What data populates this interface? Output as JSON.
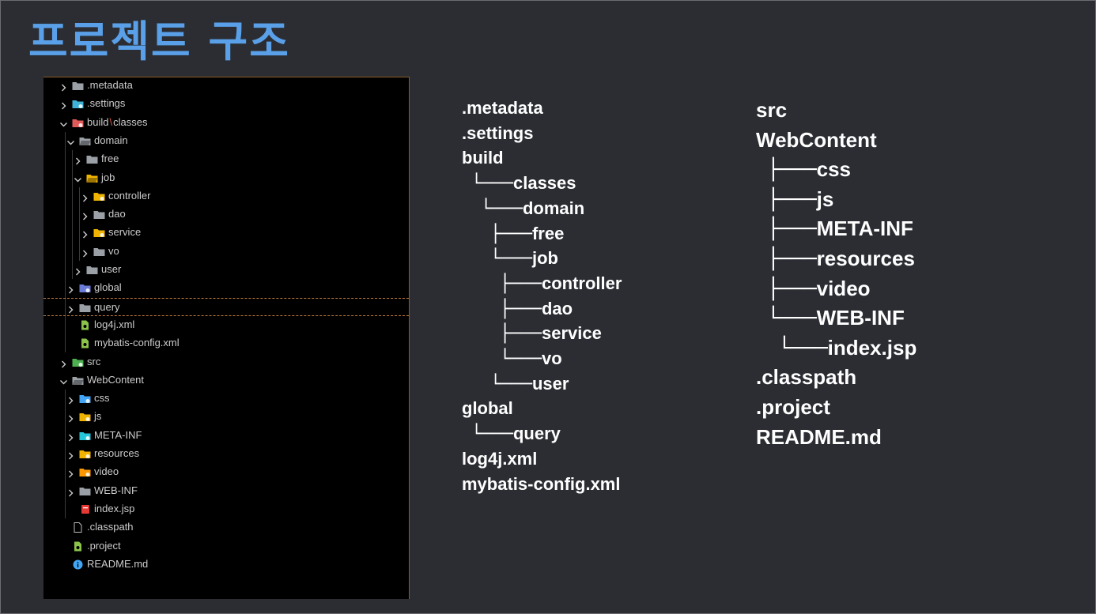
{
  "title": "프로젝트 구조",
  "explorer": {
    "items": [
      {
        "label": ".metadata",
        "icon": "folder-icon",
        "expanded": false,
        "color": "#9aa0a6"
      },
      {
        "label": ".settings",
        "icon": "settings-folder-icon",
        "expanded": false,
        "color": "#3fb2d6"
      },
      {
        "label": "build",
        "label_sep": "\\",
        "label_tail": "classes",
        "icon": "build-folder-icon",
        "expanded": true,
        "color": "#e05a5a"
      },
      {
        "label": "domain",
        "icon": "open-folder-icon",
        "expanded": true,
        "color": "#9aa0a6"
      },
      {
        "label": "free",
        "icon": "folder-icon",
        "expanded": false,
        "color": "#9aa0a6"
      },
      {
        "label": "job",
        "icon": "open-folder-icon",
        "expanded": true,
        "color": "#f0b400"
      },
      {
        "label": "controller",
        "icon": "controller-folder-icon",
        "expanded": false,
        "color": "#f0b400"
      },
      {
        "label": "dao",
        "icon": "folder-icon",
        "expanded": false,
        "color": "#9aa0a6"
      },
      {
        "label": "service",
        "icon": "service-folder-icon",
        "expanded": false,
        "color": "#f0b400"
      },
      {
        "label": "vo",
        "icon": "folder-icon",
        "expanded": false,
        "color": "#9aa0a6"
      },
      {
        "label": "user",
        "icon": "folder-icon",
        "expanded": false,
        "color": "#9aa0a6"
      },
      {
        "label": "global",
        "icon": "global-folder-icon",
        "expanded": false,
        "color": "#6a7bd8"
      },
      {
        "label": "query",
        "icon": "folder-icon",
        "expanded": false,
        "color": "#9aa0a6"
      },
      {
        "label": "log4j.xml",
        "icon": "xml-file-icon",
        "color": "#8bc34a"
      },
      {
        "label": "mybatis-config.xml",
        "icon": "xml-file-icon",
        "color": "#8bc34a"
      },
      {
        "label": "src",
        "icon": "src-folder-icon",
        "expanded": false,
        "color": "#4caf50"
      },
      {
        "label": "WebContent",
        "icon": "open-folder-icon",
        "expanded": true,
        "color": "#9aa0a6"
      },
      {
        "label": "css",
        "icon": "css-folder-icon",
        "expanded": false,
        "color": "#42a5f5"
      },
      {
        "label": "js",
        "icon": "js-folder-icon",
        "expanded": false,
        "color": "#f0b400"
      },
      {
        "label": "META-INF",
        "icon": "meta-folder-icon",
        "expanded": false,
        "color": "#26c6da"
      },
      {
        "label": "resources",
        "icon": "resources-folder-icon",
        "expanded": false,
        "color": "#f0b400"
      },
      {
        "label": "video",
        "icon": "video-folder-icon",
        "expanded": false,
        "color": "#ff9800"
      },
      {
        "label": "WEB-INF",
        "icon": "folder-icon",
        "expanded": false,
        "color": "#9aa0a6"
      },
      {
        "label": "index.jsp",
        "icon": "jsp-file-icon",
        "color": "#e53935"
      },
      {
        "label": ".classpath",
        "icon": "file-icon",
        "color": "#bdbdbd"
      },
      {
        "label": ".project",
        "icon": "project-file-icon",
        "color": "#8bc34a"
      },
      {
        "label": "README.md",
        "icon": "info-icon",
        "color": "#42a5f5"
      }
    ]
  },
  "tree_left": [
    {
      "connector": "",
      "label": ".metadata"
    },
    {
      "connector": "",
      "label": ".settings"
    },
    {
      "connector": "",
      "label": "build"
    },
    {
      "connector": "└───",
      "label": "classes"
    },
    {
      "connector": "└───",
      "label": "domain"
    },
    {
      "connector": "├───",
      "label": "free"
    },
    {
      "connector": "└───",
      "label": "job"
    },
    {
      "connector": "├───",
      "label": "controller"
    },
    {
      "connector": "├───",
      "label": "dao"
    },
    {
      "connector": "├───",
      "label": "service"
    },
    {
      "connector": "└───",
      "label": "vo"
    },
    {
      "connector": "└───",
      "label": "user"
    },
    {
      "connector": "",
      "label": "global"
    },
    {
      "connector": "└───",
      "label": "query"
    },
    {
      "connector": "",
      "label": "log4j.xml"
    },
    {
      "connector": "",
      "label": "mybatis-config.xml"
    }
  ],
  "tree_right": [
    {
      "connector": "",
      "label": "src"
    },
    {
      "connector": "",
      "label": "WebContent"
    },
    {
      "connector": "├───",
      "label": "css"
    },
    {
      "connector": "├───",
      "label": "js"
    },
    {
      "connector": "├───",
      "label": "META-INF"
    },
    {
      "connector": "├───",
      "label": "resources"
    },
    {
      "connector": "├───",
      "label": "video"
    },
    {
      "connector": "└───",
      "label": "WEB-INF"
    },
    {
      "connector": "└───",
      "label": "index.jsp"
    },
    {
      "connector": "",
      "label": ".classpath"
    },
    {
      "connector": "",
      "label": ".project"
    },
    {
      "connector": "",
      "label": "README.md"
    }
  ]
}
